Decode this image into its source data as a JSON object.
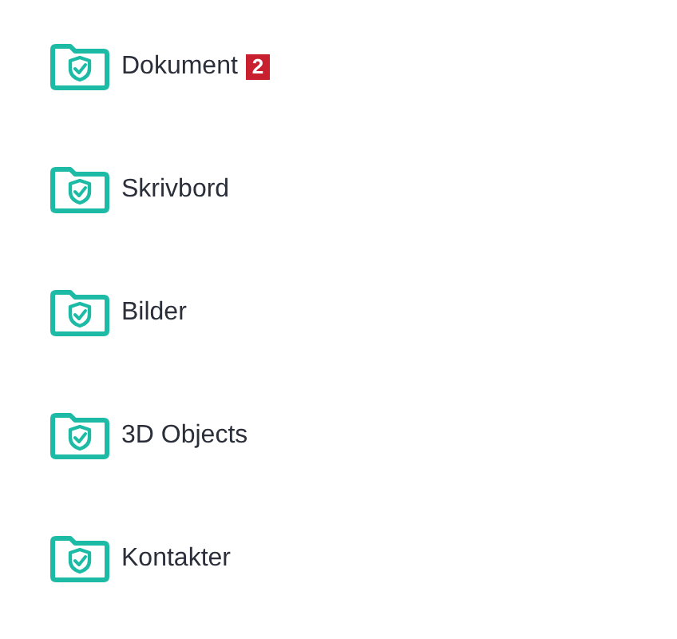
{
  "folders": [
    {
      "label": "Dokument",
      "badge": "2"
    },
    {
      "label": "Skrivbord"
    },
    {
      "label": "Bilder"
    },
    {
      "label": "3D Objects"
    },
    {
      "label": "Kontakter"
    }
  ]
}
